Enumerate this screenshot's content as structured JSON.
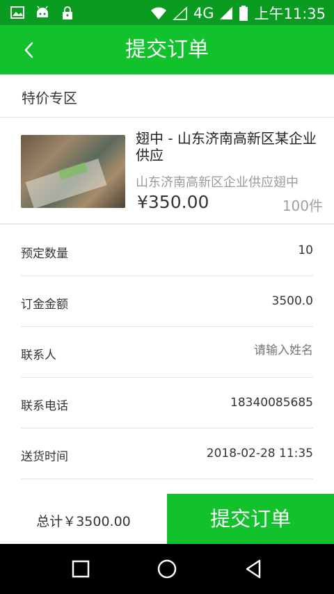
{
  "status_bar": {
    "network": "4G",
    "time": "上午11:35",
    "icons": [
      "image-icon",
      "android-icon",
      "lock-icon",
      "wifi-icon",
      "signal-icon",
      "battery-icon"
    ]
  },
  "app_bar": {
    "title": "提交订单",
    "back_icon": "chevron-left-icon"
  },
  "section": {
    "title": "特价专区"
  },
  "product": {
    "title": "翅中 - 山东济南高新区某企业供应",
    "subtitle": "山东济南高新区企业供应翅中",
    "price": "¥350.00",
    "stock": "100件"
  },
  "form": {
    "quantity_label": "预定数量",
    "quantity_value": "10",
    "deposit_label": "订金金额",
    "deposit_value": "3500.0",
    "contact_label": "联系人",
    "contact_placeholder": "请输入姓名",
    "phone_label": "联系电话",
    "phone_value": "18340085685",
    "delivery_label": "送货时间",
    "delivery_value": "2018-02-28 11:35"
  },
  "bottom": {
    "total": "总计￥3500.00",
    "submit_label": "提交订单"
  },
  "colors": {
    "accent": "#12c22c",
    "status_bar": "#0a9c20"
  }
}
